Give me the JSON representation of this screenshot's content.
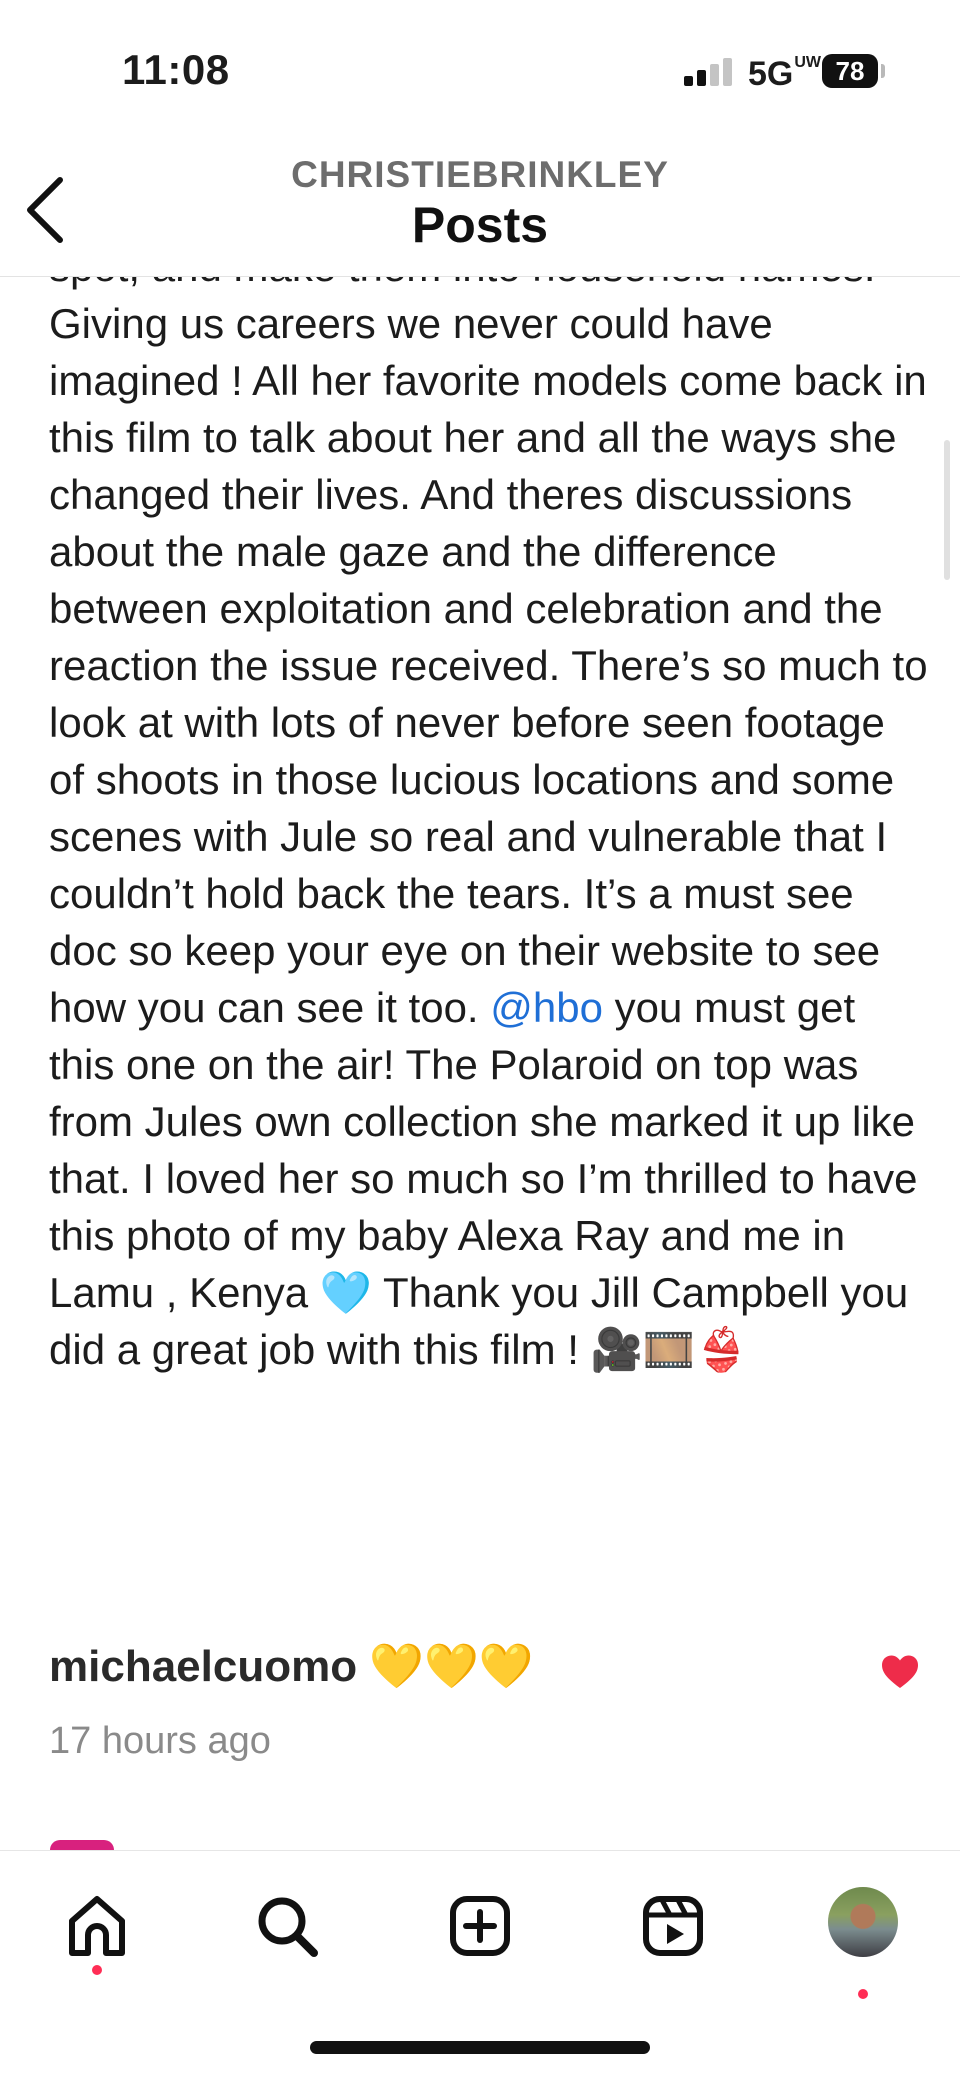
{
  "status_bar": {
    "time": "11:08",
    "network": "5G",
    "network_superscript": "UW",
    "battery": "78"
  },
  "header": {
    "username": "CHRISTIEBRINKLEY",
    "title": "Posts"
  },
  "caption": {
    "text_before_mention": "spot, and make them into household names! Giving us careers we never could have imagined ! All her favorite models come back in this film to talk about her and all the ways she changed their lives. And theres discussions about the male gaze and the difference between exploitation and celebration and the reaction the issue received. There’s so much to look at with lots of never before seen footage of shoots in those lucious locations and some scenes with Jule so real and vulnerable that I couldn’t hold back the tears. It’s a must see doc so keep your eye on their website to see how you can see it too.",
    "mention": "@hbo",
    "text_after_mention": " you must get this one on the air! The Polaroid on top was from Jules own collection she marked it up like that. I loved her so much so I’m thrilled to have this photo of my baby Alexa Ray and me in Lamu , Kenya 🩵 Thank you Jill Campbell you did a great job with this film ! 🎥🎞️👙"
  },
  "comment": {
    "username": "michaelcuomo",
    "text": " 💛💛💛",
    "time": "17 hours ago",
    "liked": true,
    "heart_color": "#ee2c4a"
  },
  "nav": {
    "items": [
      "home-icon",
      "search-icon",
      "create-icon",
      "reels-icon",
      "profile-avatar"
    ],
    "notification_color": "#ff2d55"
  },
  "colors": {
    "mention": "#1f6fd6",
    "text": "#1c1c1c",
    "secondary_text": "#8a8a8a"
  }
}
